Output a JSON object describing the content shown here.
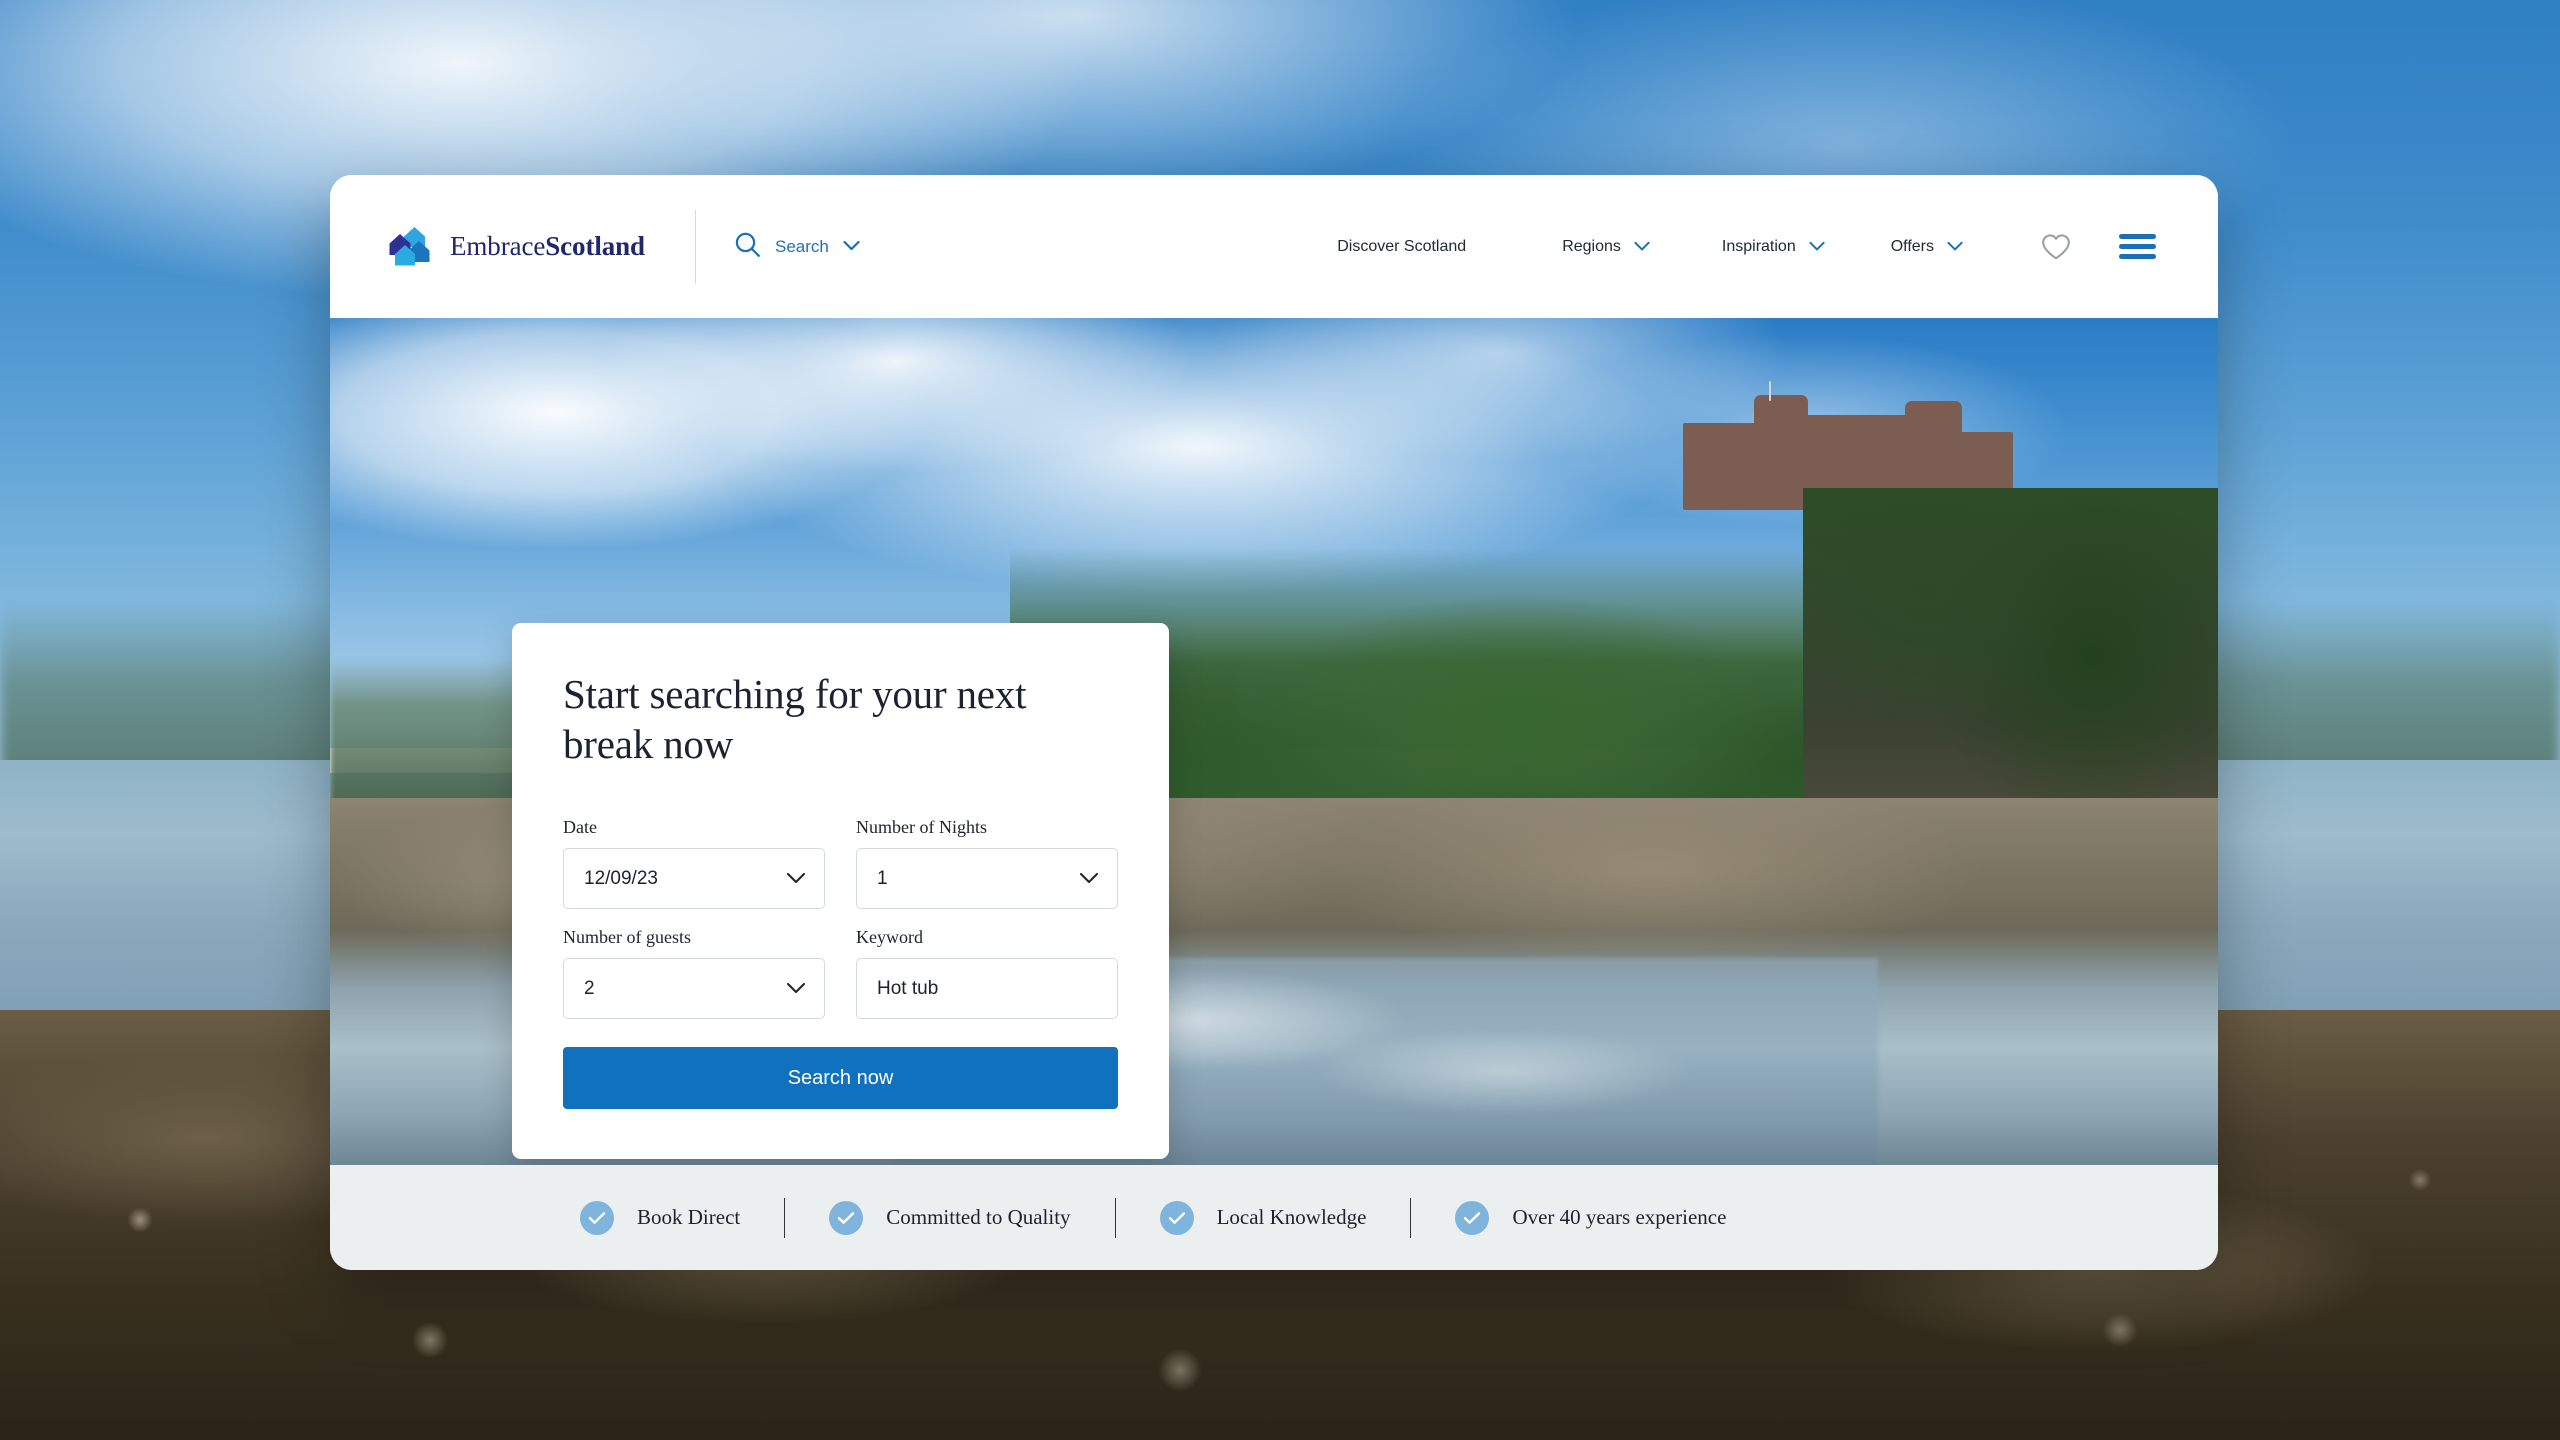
{
  "brand": {
    "name_light": "Embrace",
    "name_bold": "Scotland",
    "logo_icon": "house-cluster-logo",
    "logo_colors": [
      "#2fa6e0",
      "#2e3192",
      "#1b75bc",
      "#29abe2"
    ]
  },
  "header": {
    "search": {
      "label": "Search",
      "icon": "search-icon",
      "chevron_icon": "chevron-down-icon"
    },
    "nav": [
      {
        "label": "Discover Scotland",
        "has_chevron": false
      },
      {
        "label": "Regions",
        "has_chevron": true
      },
      {
        "label": "Inspiration",
        "has_chevron": true
      },
      {
        "label": "Offers",
        "has_chevron": true
      }
    ],
    "wishlist_icon": "heart-icon",
    "menu_icon": "hamburger-menu-icon",
    "accent_color": "#1a6fb5"
  },
  "hero": {
    "alt": "Culzean Castle above a rocky Scottish shoreline with reflections in a tidal pool"
  },
  "search_card": {
    "heading": "Start searching for your next break now",
    "fields": [
      {
        "key": "date",
        "label": "Date",
        "value": "12/09/23",
        "type": "select",
        "icon": "chevron-down-icon"
      },
      {
        "key": "nights",
        "label": "Number of Nights",
        "value": "1",
        "type": "select",
        "icon": "chevron-down-icon"
      },
      {
        "key": "guests",
        "label": "Number of guests",
        "value": "2",
        "type": "select",
        "icon": "chevron-down-icon"
      },
      {
        "key": "keyword",
        "label": "Keyword",
        "value": "Hot tub",
        "placeholder": "Keyword",
        "type": "text"
      }
    ],
    "submit_label": "Search now",
    "submit_color": "#1071be"
  },
  "trust_bar": {
    "items": [
      {
        "label": "Book Direct",
        "icon": "check-circle-icon"
      },
      {
        "label": "Committed to Quality",
        "icon": "check-circle-icon"
      },
      {
        "label": "Local Knowledge",
        "icon": "check-circle-icon"
      },
      {
        "label": "Over 40 years experience",
        "icon": "check-circle-icon"
      }
    ],
    "background": "#eceff0",
    "check_color": "#7fb4dc"
  }
}
